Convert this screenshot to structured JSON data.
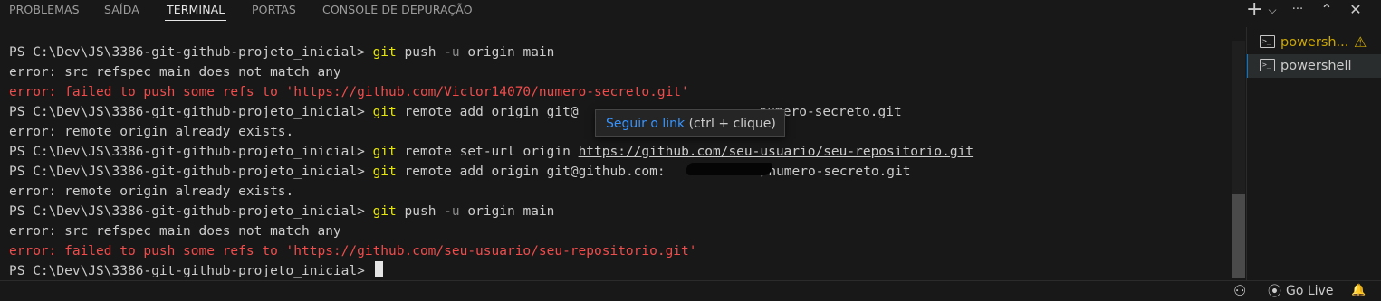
{
  "panel": {
    "tabs": [
      {
        "label": "PROBLEMAS"
      },
      {
        "label": "SAÍDA"
      },
      {
        "label": "TERMINAL"
      },
      {
        "label": "PORTAS"
      },
      {
        "label": "CONSOLE DE DEPURAÇÃO"
      }
    ],
    "active_tab": "TERMINAL"
  },
  "actions": {
    "new_terminal": "+",
    "dropdown": "⌵",
    "more": "···",
    "maximize": "⌃",
    "close": "✕"
  },
  "terminal": {
    "prompt": "PS C:\\Dev\\JS\\3386-git-github-projeto_inicial>",
    "l1_git": "git",
    "l1_push": "push",
    "l1_flag": "-u",
    "l1_rest": "origin main",
    "l2": "error: src refspec main does not match any",
    "l3": "error: failed to push some refs to 'https://github.com/Victor14070/numero-secreto.git'",
    "l4_git": "git",
    "l4_rest": "remote add origin git@",
    "l4_tail": "numero-secreto.git",
    "l5": "error: remote origin already exists.",
    "l6_git": "git",
    "l6_rest": "remote set-url origin",
    "l6_url": "https://github.com/seu-usuario/seu-repositorio.git",
    "l7_git": "git",
    "l7_rest": "remote add origin git@github.com:",
    "l7_tail": "/numero-secreto.git",
    "l8": "error: remote origin already exists.",
    "l9_git": "git",
    "l9_push": "push",
    "l9_flag": "-u",
    "l9_rest": "origin main",
    "l10": "error: src refspec main does not match any",
    "l11": "error: failed to push some refs to 'https://github.com/seu-usuario/seu-repositorio.git'"
  },
  "tooltip": {
    "link": "Seguir o link",
    "hint": "(ctrl + clique)"
  },
  "terminal_list": [
    {
      "name": "powersh...",
      "warning": true
    },
    {
      "name": "powershell",
      "warning": false
    }
  ],
  "status": {
    "copilot": "⚇",
    "golive_icon": "⦿",
    "golive": "Go Live",
    "bell": "🔔"
  },
  "colors": {
    "background": "#181818",
    "command_yellow": "#e5e510",
    "error_red": "#f14c4c",
    "link_blue": "#3794ff",
    "warning": "#cca700"
  }
}
